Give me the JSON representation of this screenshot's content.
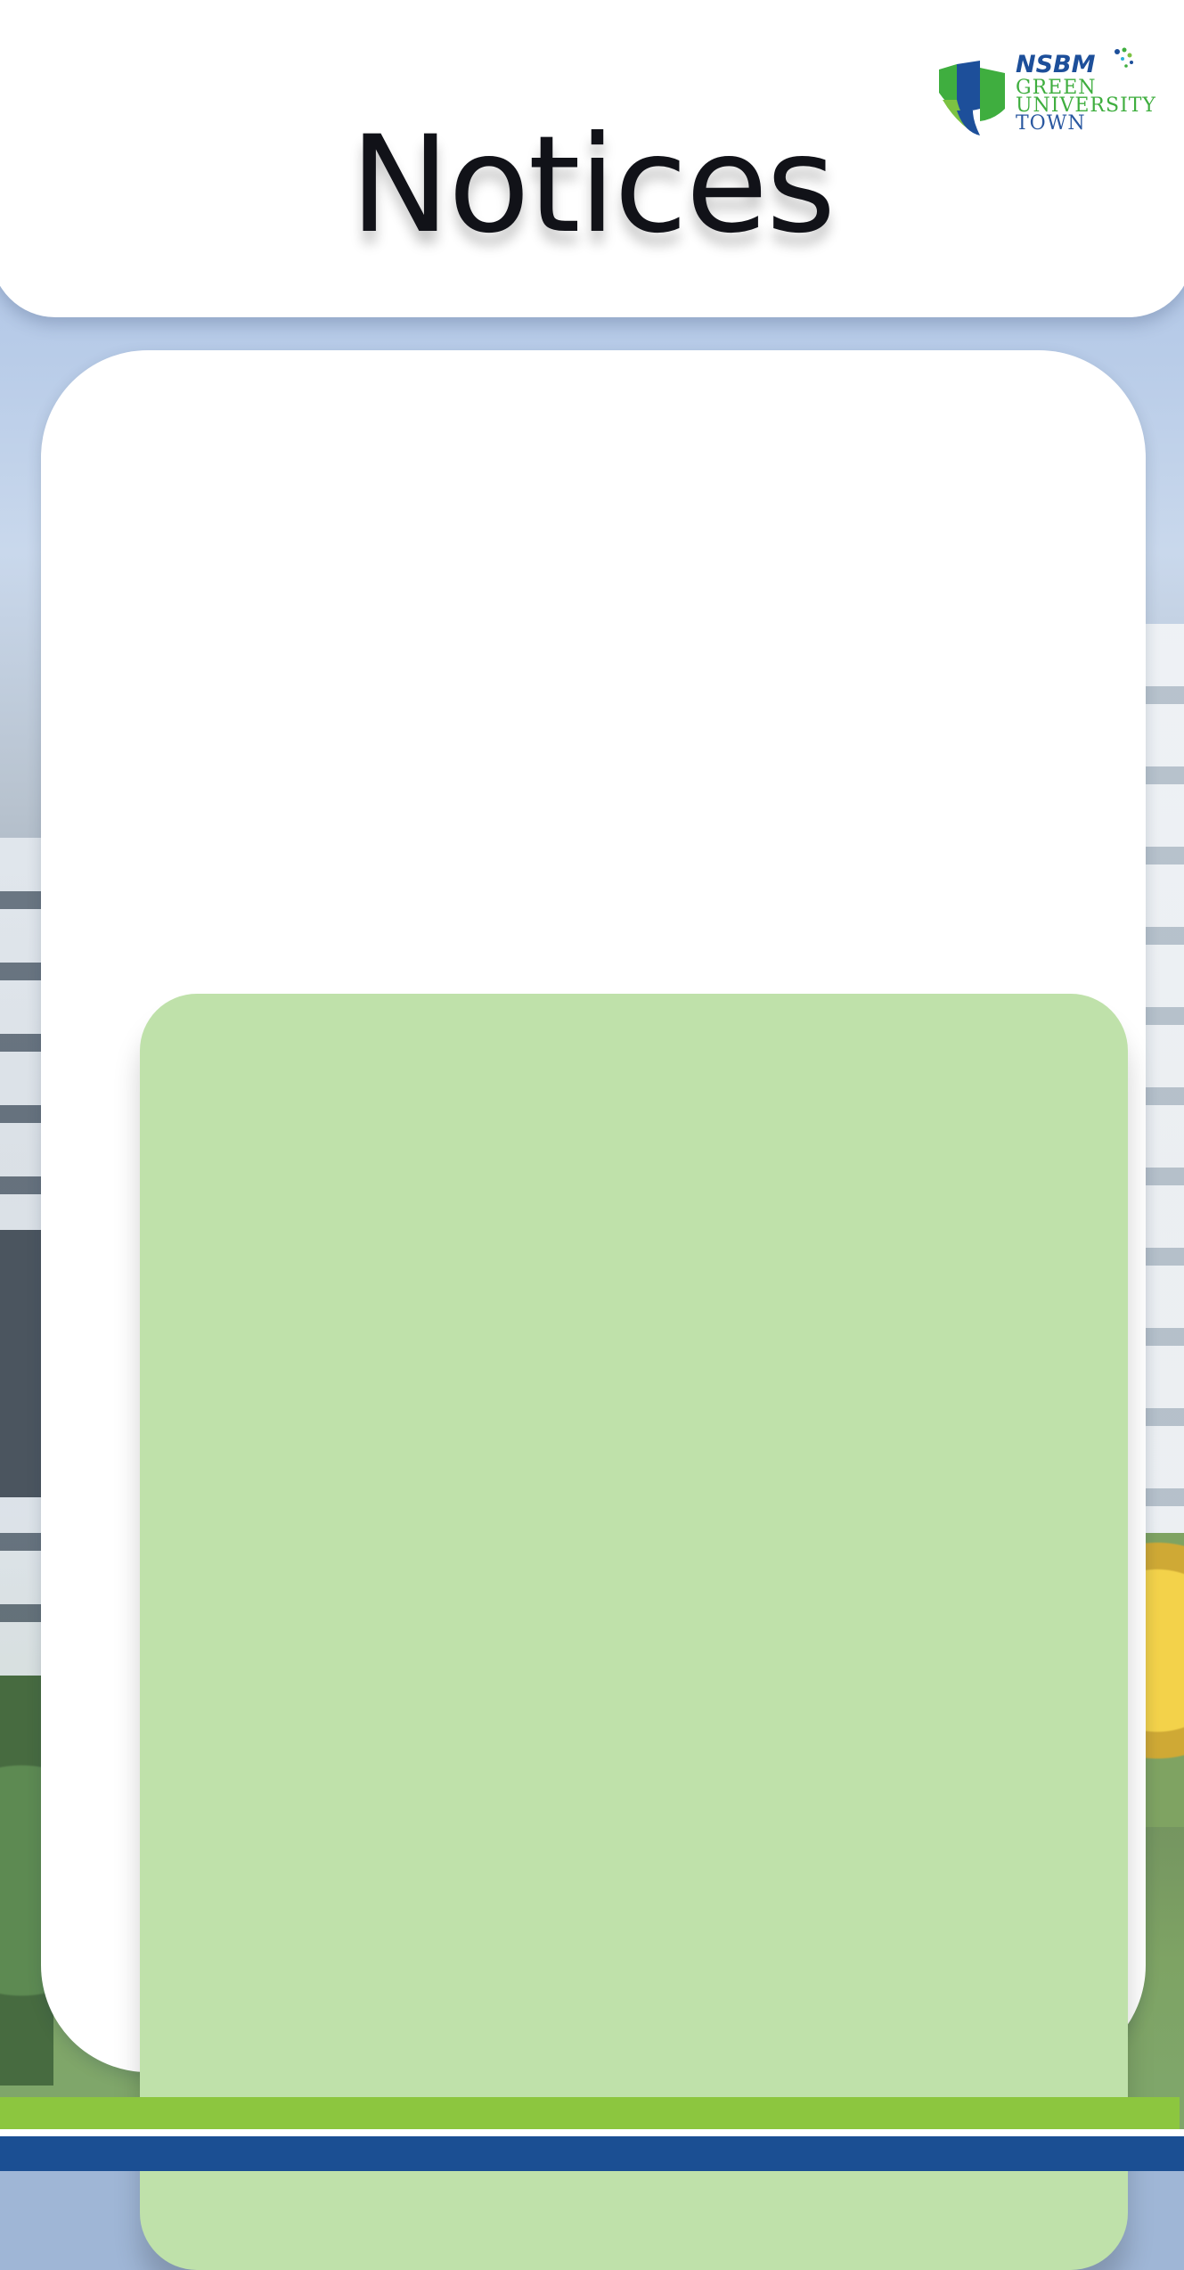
{
  "header": {
    "title": "Notices"
  },
  "logo": {
    "brand": "NSBM",
    "line1": "GREEN",
    "line2": "UNIVERSITY",
    "line3": "TOWN",
    "icon": "nsbm-shield-logo"
  },
  "notice_board": {
    "panel_color": "#bfe1aa",
    "items": []
  },
  "colors": {
    "header_background": "#ffffff",
    "title_text": "#111218",
    "footer_green": "#8cc63f",
    "footer_blue": "#1b4f93",
    "logo_blue": "#1d4f9a",
    "logo_green": "#3fae3f"
  }
}
